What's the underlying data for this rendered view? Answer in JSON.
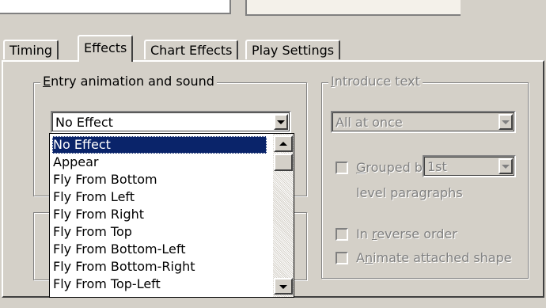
{
  "tabs": [
    {
      "label": "Timing"
    },
    {
      "label": "Effects"
    },
    {
      "label": "Chart Effects"
    },
    {
      "label": "Play Settings"
    }
  ],
  "entry_group": {
    "label_mnemonic": "E",
    "label_rest": "ntry animation and sound",
    "effect_combo_value": "No Effect",
    "list_items": [
      "No Effect",
      "Appear",
      "Fly From Bottom",
      "Fly From Left",
      "Fly From Right",
      "Fly From Top",
      "Fly From Bottom-Left",
      "Fly From Bottom-Right",
      "Fly From Top-Left"
    ],
    "selected_index": 0
  },
  "introduce_group": {
    "label_mnemonic": "I",
    "label_rest": "ntroduce text",
    "combo_value": "All at once",
    "grouped_mnemonic": "G",
    "grouped_rest": "rouped by",
    "level_combo_value": "1st",
    "level_paragraphs": "level paragraphs",
    "reverse_pre": "In ",
    "reverse_mnemonic": "r",
    "reverse_rest": "everse order",
    "animate_pre": "A",
    "animate_mnemonic": "n",
    "animate_rest": "imate attached shape"
  }
}
